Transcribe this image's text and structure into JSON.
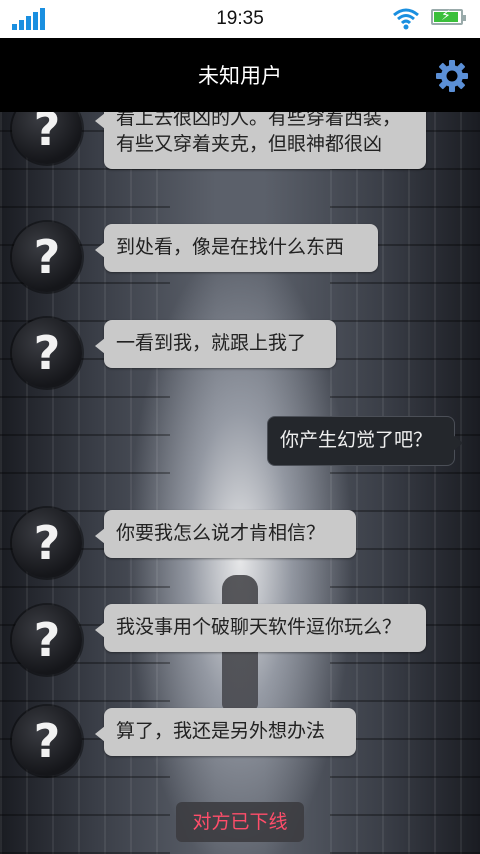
{
  "status_bar": {
    "time": "19:35",
    "colors": {
      "signal": "#1a8fe0",
      "battery": "#3bbf3b"
    }
  },
  "header": {
    "title": "未知用户",
    "settings_icon": "gear-icon",
    "settings_color": "#5b8fd6"
  },
  "chat": {
    "avatar_symbol": "?",
    "messages": [
      {
        "from": "other",
        "text": "看上去很凶的人。有些穿着西装，有些又穿着夹克，但眼神都很凶"
      },
      {
        "from": "other",
        "text": "到处看，像是在找什么东西"
      },
      {
        "from": "other",
        "text": "一看到我，就跟上我了"
      },
      {
        "from": "me",
        "text": "你产生幻觉了吧？"
      },
      {
        "from": "other",
        "text": "你要我怎么说才肯相信？"
      },
      {
        "from": "other",
        "text": "我没事用个破聊天软件逗你玩么？"
      },
      {
        "from": "other",
        "text": "算了，我还是另外想办法"
      }
    ],
    "status_notice": "对方已下线"
  }
}
